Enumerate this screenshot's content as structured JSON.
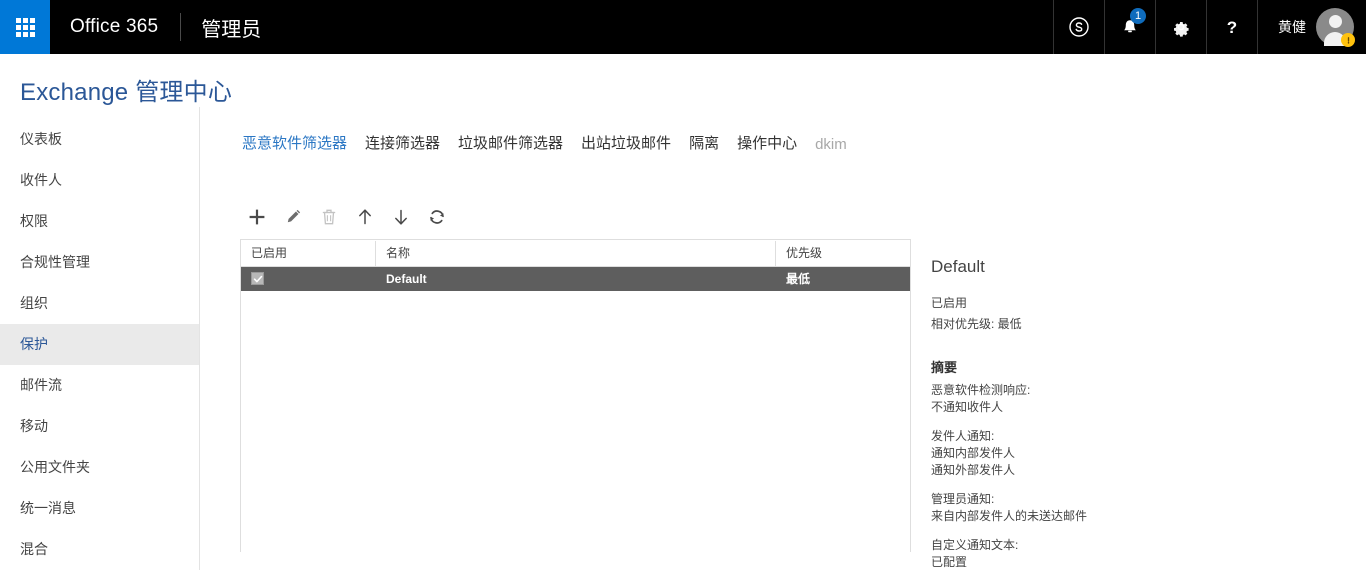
{
  "suite": {
    "waffle_label": "app-launcher",
    "brand": "Office 365",
    "sub_brand": "管理员",
    "icons": [
      {
        "name": "skype-icon",
        "label": "Skype"
      },
      {
        "name": "notifications-icon",
        "label": "通知",
        "badge": "1"
      },
      {
        "name": "settings-gear-icon",
        "label": "设置"
      },
      {
        "name": "help-icon",
        "label": "帮助"
      }
    ],
    "user_name": "黄健"
  },
  "eac": {
    "title_prefix": "Exchange",
    "title_suffix": "管理中心"
  },
  "sidebar": {
    "items": [
      {
        "label": "仪表板",
        "active": false
      },
      {
        "label": "收件人",
        "active": false
      },
      {
        "label": "权限",
        "active": false
      },
      {
        "label": "合规性管理",
        "active": false
      },
      {
        "label": "组织",
        "active": false
      },
      {
        "label": "保护",
        "active": true
      },
      {
        "label": "邮件流",
        "active": false
      },
      {
        "label": "移动",
        "active": false
      },
      {
        "label": "公用文件夹",
        "active": false
      },
      {
        "label": "统一消息",
        "active": false
      },
      {
        "label": "混合",
        "active": false
      }
    ]
  },
  "tabs": [
    {
      "label": "恶意软件筛选器",
      "state": "active"
    },
    {
      "label": "连接筛选器",
      "state": "normal"
    },
    {
      "label": "垃圾邮件筛选器",
      "state": "normal"
    },
    {
      "label": "出站垃圾邮件",
      "state": "normal"
    },
    {
      "label": "隔离",
      "state": "normal"
    },
    {
      "label": "操作中心",
      "state": "normal"
    },
    {
      "label": "dkim",
      "state": "muted"
    }
  ],
  "toolbar": {
    "buttons": [
      {
        "name": "add-button",
        "icon": "plus-icon",
        "label": "新建",
        "enabled": true
      },
      {
        "name": "edit-button",
        "icon": "pencil-icon",
        "label": "编辑",
        "enabled": true
      },
      {
        "name": "delete-button",
        "icon": "trash-icon",
        "label": "删除",
        "enabled": false
      },
      {
        "name": "move-up-button",
        "icon": "arrow-up-icon",
        "label": "上移",
        "enabled": true
      },
      {
        "name": "move-down-button",
        "icon": "arrow-down-icon",
        "label": "下移",
        "enabled": true
      },
      {
        "name": "refresh-button",
        "icon": "refresh-icon",
        "label": "刷新",
        "enabled": true
      }
    ]
  },
  "grid": {
    "columns": [
      "已启用",
      "名称",
      "优先级"
    ],
    "rows": [
      {
        "enabled": true,
        "name": "Default",
        "priority": "最低",
        "selected": true
      }
    ]
  },
  "details": {
    "title": "Default",
    "enabled_text": "已启用",
    "priority_text": "相对优先级: 最低",
    "summary_heading": "摘要",
    "groups": [
      {
        "label": "恶意软件检测响应:",
        "values": [
          "不通知收件人"
        ]
      },
      {
        "label": "发件人通知:",
        "values": [
          "通知内部发件人",
          "通知外部发件人"
        ]
      },
      {
        "label": "管理员通知:",
        "values": [
          "来自内部发件人的未送达邮件"
        ]
      },
      {
        "label": "自定义通知文本:",
        "values": [
          "已配置"
        ]
      }
    ]
  },
  "colors": {
    "accent_blue": "#0078d7",
    "title_blue": "#2b5797",
    "tab_active": "#2b77c4",
    "row_selected": "#5e5e5e",
    "badge_blue": "#0f6cbd",
    "status_yellow": "#ffc20e"
  }
}
